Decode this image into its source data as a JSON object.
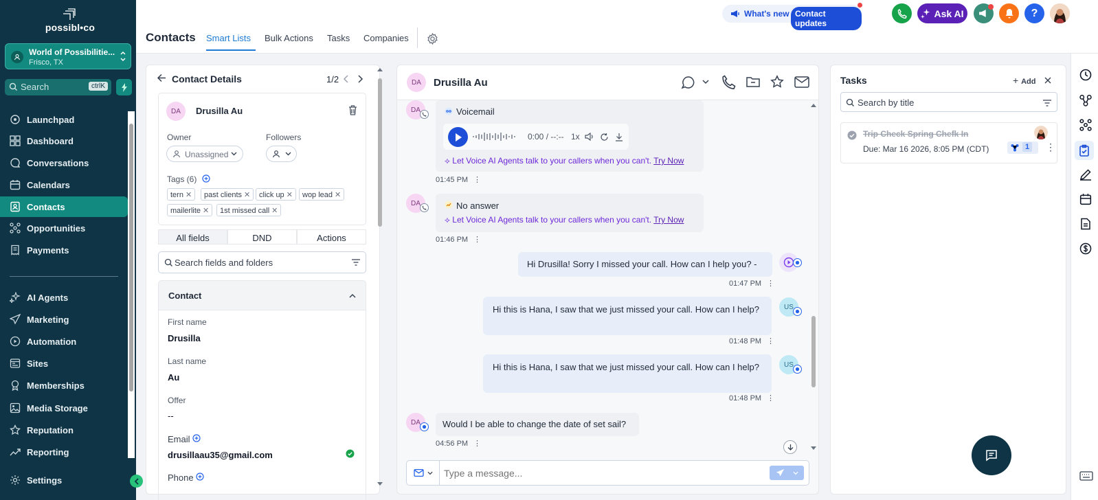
{
  "brand": {
    "logo": "possibl•co"
  },
  "location": {
    "name": "World of Possibilitie...",
    "address": "Frisco, TX"
  },
  "sidebar_search": {
    "placeholder": "Search",
    "shortcut": "ctrlK"
  },
  "nav": [
    {
      "label": "Launchpad",
      "icon": "rocket-icon"
    },
    {
      "label": "Dashboard",
      "icon": "dashboard-icon"
    },
    {
      "label": "Conversations",
      "icon": "chat-icon"
    },
    {
      "label": "Calendars",
      "icon": "calendar-icon"
    },
    {
      "label": "Contacts",
      "icon": "contacts-icon",
      "active": true
    },
    {
      "label": "Opportunities",
      "icon": "opportunities-icon"
    },
    {
      "label": "Payments",
      "icon": "payments-icon"
    },
    {
      "label": "AI Agents",
      "icon": "sparkle-icon"
    },
    {
      "label": "Marketing",
      "icon": "send-icon"
    },
    {
      "label": "Automation",
      "icon": "automation-icon"
    },
    {
      "label": "Sites",
      "icon": "sites-icon"
    },
    {
      "label": "Memberships",
      "icon": "membership-icon"
    },
    {
      "label": "Media Storage",
      "icon": "image-icon"
    },
    {
      "label": "Reputation",
      "icon": "star-icon"
    },
    {
      "label": "Reporting",
      "icon": "chart-icon"
    },
    {
      "label": "Settings",
      "icon": "gear-icon"
    }
  ],
  "header": {
    "title": "Contacts",
    "tabs": [
      "Smart Lists",
      "Bulk Actions",
      "Tasks",
      "Companies"
    ],
    "whats_new": "What's new",
    "contact_updates": "Contact updates",
    "ask_ai": "Ask AI"
  },
  "contact_details": {
    "title": "Contact Details",
    "pager": "1/2",
    "initials": "DA",
    "name": "Drusilla Au",
    "owner_label": "Owner",
    "owner_value": "Unassigned",
    "followers_label": "Followers",
    "tags_label": "Tags (6)",
    "tags": [
      "tern",
      "past clients",
      "click up",
      "wop lead",
      "mailerlite",
      "1st missed call"
    ],
    "segments": [
      "All fields",
      "DND",
      "Actions"
    ],
    "search_placeholder": "Search fields and folders",
    "section_title": "Contact",
    "fields": [
      {
        "label": "First name",
        "value": "Drusilla"
      },
      {
        "label": "Last name",
        "value": "Au"
      },
      {
        "label": "Offer",
        "value": "--"
      }
    ],
    "email_label": "Email",
    "email_value": "drusillaau35@gmail.com",
    "phone_label": "Phone"
  },
  "conversation": {
    "initials": "DA",
    "name": "Drusilla Au",
    "voicemail_label": "Voicemail",
    "audio_time": "0:00 / --:--",
    "audio_speed": "1x",
    "promo_text": "Let Voice AI Agents talk to your callers when you can't.",
    "promo_link": "Try Now",
    "no_answer_label": "No answer",
    "messages": [
      {
        "time": "01:45 PM"
      },
      {
        "time": "01:46 PM"
      },
      {
        "text": "Hi Drusilla! Sorry I missed your call. How can I help you? -",
        "time": "01:47 PM"
      },
      {
        "text": "Hi this is Hana, I saw that we just missed your call. How can I help?",
        "time": "01:48 PM",
        "avatar": "US"
      },
      {
        "text": "Hi this is Hana, I saw that we just missed your call. How can I help?",
        "time": "01:48 PM",
        "avatar": "US"
      },
      {
        "text": "Would I be able to change the date of set sail?",
        "time": "04:56 PM",
        "avatar": "DA"
      }
    ],
    "composer_placeholder": "Type a message..."
  },
  "tasks": {
    "title": "Tasks",
    "add_label": "Add",
    "search_placeholder": "Search by title",
    "items": [
      {
        "title": "Trip Check Spring Chefk In",
        "due": "Due: Mar 16 2026, 8:05 PM (CDT)",
        "count": "1"
      }
    ]
  },
  "colors": {
    "sidebar": "#0e3445",
    "accent": "#138a80",
    "link": "#1d7bd3",
    "purple": "#5b21b6"
  }
}
